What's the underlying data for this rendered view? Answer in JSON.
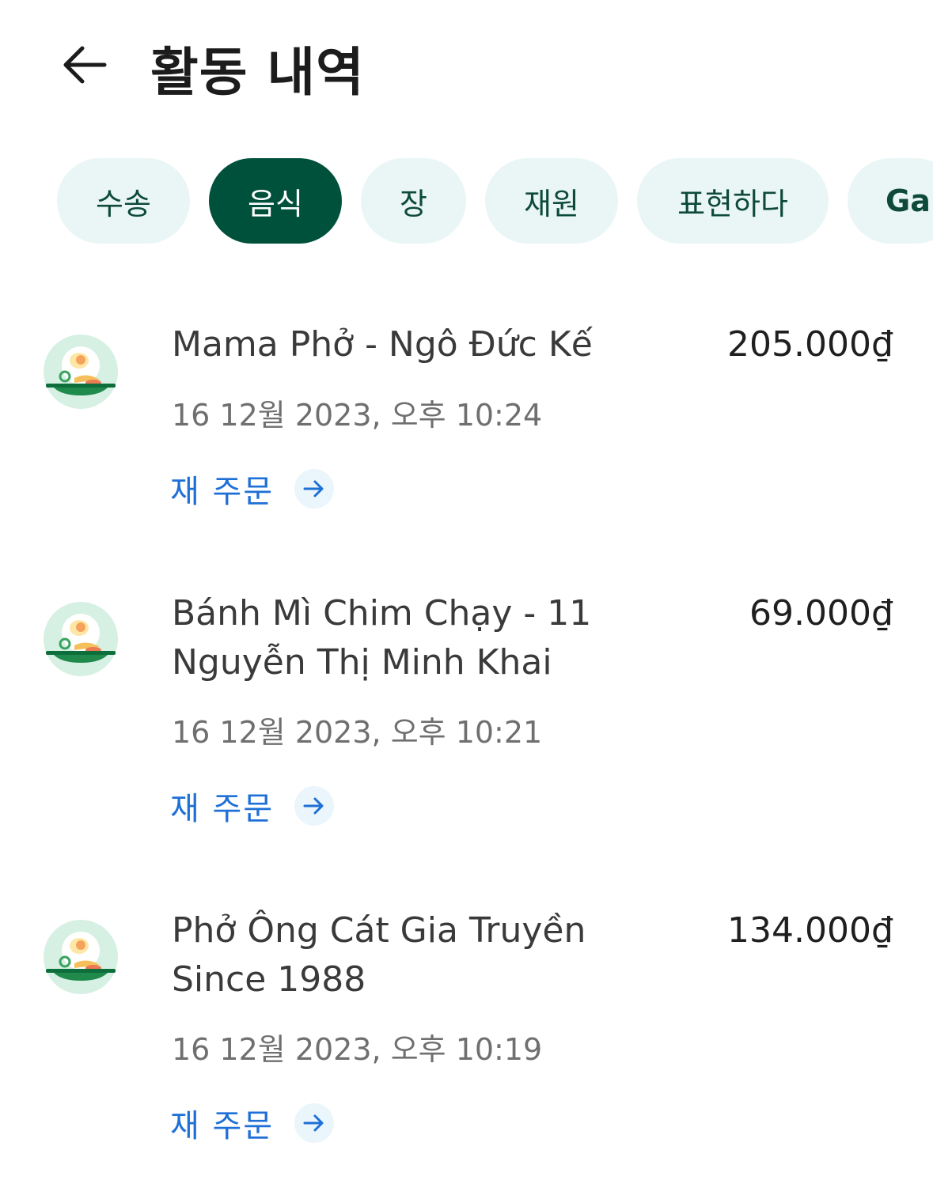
{
  "header": {
    "title": "활동 내역",
    "back_icon": "arrow-left-icon"
  },
  "tabs": [
    {
      "label": "수송",
      "active": false
    },
    {
      "label": "음식",
      "active": true
    },
    {
      "label": "장",
      "active": false
    },
    {
      "label": "재원",
      "active": false
    },
    {
      "label": "표현하다",
      "active": false
    },
    {
      "label": "Ga",
      "active": false
    }
  ],
  "orders": [
    {
      "store": "Mama Phở - Ngô Đức Kế",
      "price": "205.000₫",
      "date": "16 12월 2023, 오후 10:24",
      "reorder_label": "재 주문",
      "icon": "food-plate-icon"
    },
    {
      "store": "Bánh Mì Chim Chạy - 11 Nguyễn Thị Minh Khai",
      "price": "69.000₫",
      "date": "16 12월 2023, 오후 10:21",
      "reorder_label": "재 주문",
      "icon": "food-plate-icon"
    },
    {
      "store": "Phở Ông Cát Gia Truyền Since 1988",
      "price": "134.000₫",
      "date": "16 12월 2023, 오후 10:19",
      "reorder_label": "재 주문",
      "icon": "food-plate-icon"
    }
  ],
  "colors": {
    "active_tab": "#00513b",
    "inactive_tab": "#eaf6f6",
    "tab_text": "#0d4a3a",
    "link": "#1e6fd6",
    "date_text": "#6f6f6f"
  }
}
